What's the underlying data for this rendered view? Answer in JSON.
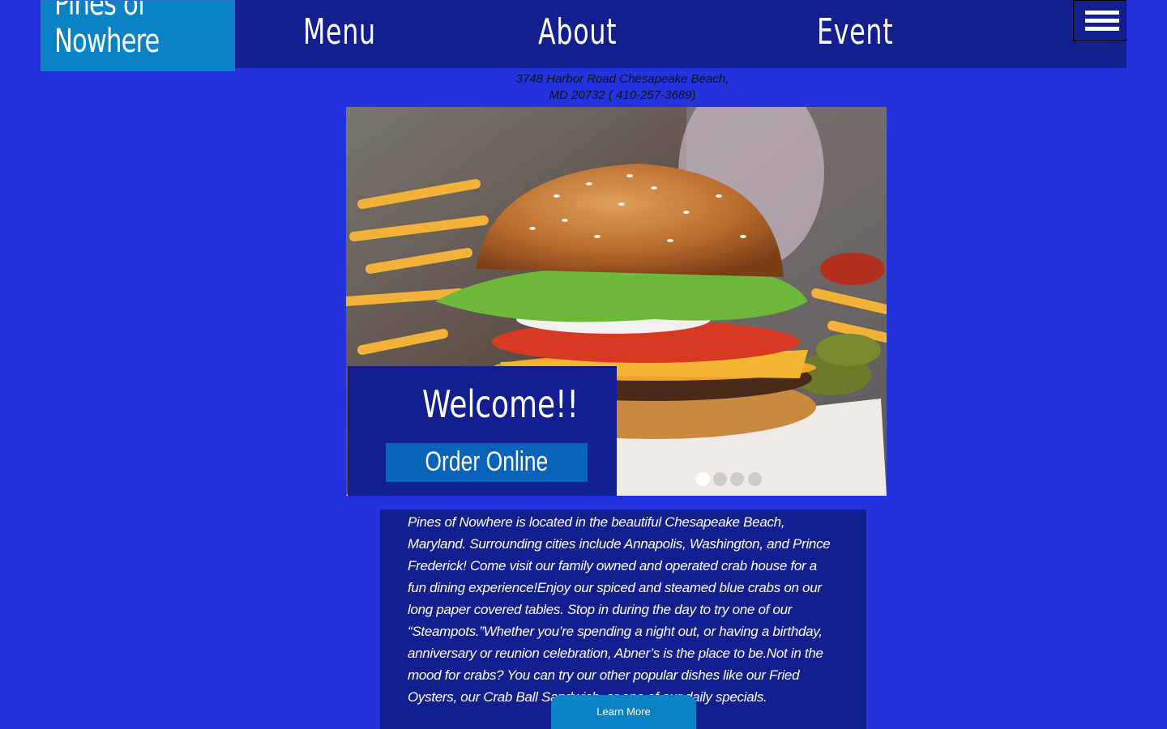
{
  "brand": {
    "name_line1": "Pines of",
    "name_line2": "Nowhere"
  },
  "nav": {
    "menu": "Menu",
    "about": "About",
    "event": "Event"
  },
  "menu_toggle": {
    "icon": "hamburger-menu-icon"
  },
  "address": {
    "line1": "3748 Harbor Road Chesapeake Beach,",
    "line2": "MD 20732 ( 410-257-3689)"
  },
  "hero": {
    "image": "burger-and-fries-photo",
    "welcome": "Welcome!!",
    "order_button": "Order Online",
    "slide_count": 4,
    "active_slide": 1
  },
  "about": {
    "text": " Pines of Nowhere is located in the beautiful Chesapeake Beach, Maryland. Surrounding cities include Annapolis, Washington, and Prince Frederick! Come visit our family owned and operated crab house for a fun dining experience!Enjoy our spiced and steamed blue crabs on our long paper covered tables. Stop in during the day to try one of our “Steampots.”Whether you’re spending a night out, or having a birthday, anniversary or reunion celebration, Abner’s is the place to be.Not in the mood for crabs? You can try our other popular dishes like our Fried Oysters, our Crab Ball Sandwich, or one of our daily specials.",
    "learn_more": "Learn More"
  },
  "colors": {
    "page_bg": "#2233dd",
    "nav_bg": "#131f8e",
    "logo_bg": "#0a82c6",
    "button_bg": "#0a62b9"
  }
}
